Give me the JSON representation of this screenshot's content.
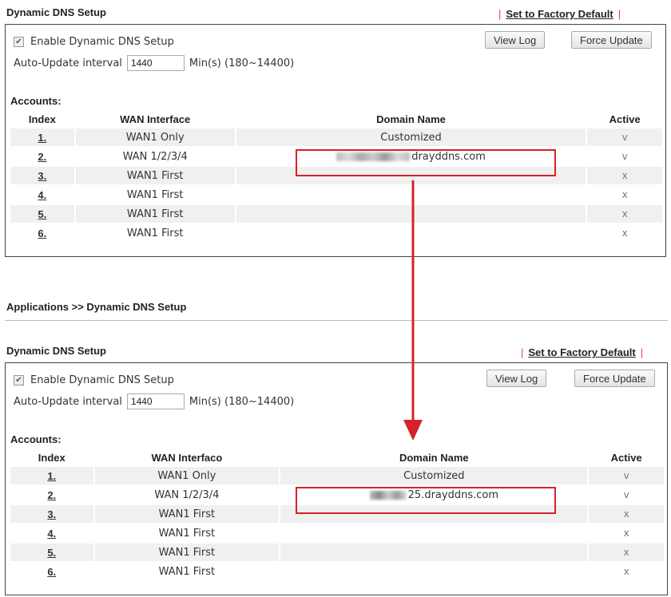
{
  "top": {
    "title": "Dynamic DNS Setup",
    "factory_label": "Set to Factory Default",
    "enable_label": "Enable Dynamic DNS Setup",
    "interval_label": "Auto-Update interval",
    "interval_value": "1440",
    "interval_unit": "Min(s) (180~14400)",
    "view_log": "View Log",
    "force_update": "Force Update",
    "accounts_label": "Accounts:",
    "columns": {
      "index": "Index",
      "wan": "WAN Interface",
      "domain": "Domain Name",
      "active": "Active"
    },
    "rows": [
      {
        "index": "1.",
        "wan": "WAN1 Only",
        "domain": "Customized",
        "active": "v"
      },
      {
        "index": "2.",
        "wan": "WAN 1/2/3/4",
        "domain": "drayddns.com",
        "active": "v"
      },
      {
        "index": "3.",
        "wan": "WAN1 First",
        "domain": "",
        "active": "x"
      },
      {
        "index": "4.",
        "wan": "WAN1 First",
        "domain": "",
        "active": "x"
      },
      {
        "index": "5.",
        "wan": "WAN1 First",
        "domain": "",
        "active": "x"
      },
      {
        "index": "6.",
        "wan": "WAN1 First",
        "domain": "",
        "active": "x"
      }
    ]
  },
  "breadcrumb": "Applications >> Dynamic DNS Setup",
  "bottom": {
    "title": "Dynamic DNS Setup",
    "factory_label": "Set to Factory Default",
    "enable_label": "Enable Dynamic DNS Setup",
    "interval_label": "Auto-Update interval",
    "interval_value": "1440",
    "interval_unit": "Min(s) (180~14400)",
    "view_log": "View Log",
    "force_update": "Force Update",
    "accounts_label": "Accounts:",
    "columns": {
      "index": "Index",
      "wan": "WAN Interfaco",
      "domain": "Domain Name",
      "active": "Active"
    },
    "rows": [
      {
        "index": "1.",
        "wan": "WAN1 Only",
        "domain": "Customized",
        "active": "v"
      },
      {
        "index": "2.",
        "wan": "WAN 1/2/3/4",
        "domain": "25.drayddns.com",
        "active": "v"
      },
      {
        "index": "3.",
        "wan": "WAN1 First",
        "domain": "",
        "active": "x"
      },
      {
        "index": "4.",
        "wan": "WAN1 First",
        "domain": "",
        "active": "x"
      },
      {
        "index": "5.",
        "wan": "WAN1 First",
        "domain": "",
        "active": "x"
      },
      {
        "index": "6.",
        "wan": "WAN1 First",
        "domain": "",
        "active": "x"
      }
    ]
  },
  "colors": {
    "highlight": "#d8202a",
    "row_alt": "#f0f0f0"
  },
  "icons": {
    "arrow": "down-arrow-icon"
  }
}
